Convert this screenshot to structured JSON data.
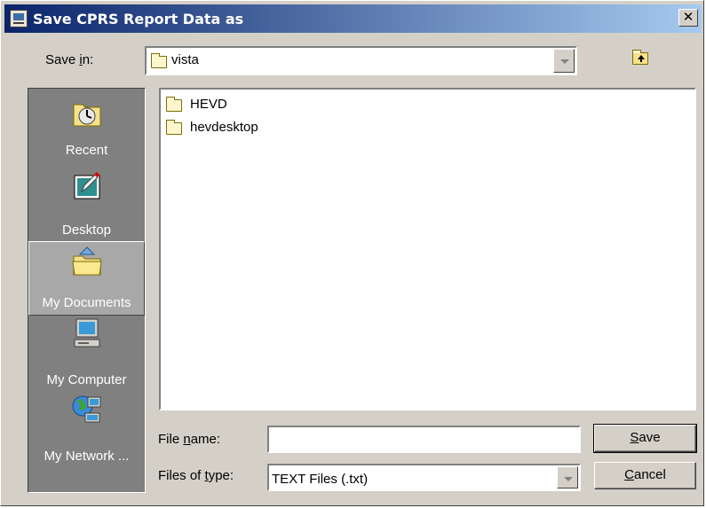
{
  "window": {
    "title": "Save CPRS Report Data as",
    "close_glyph": "✕"
  },
  "save_in": {
    "label_pre": "Save ",
    "label_accel": "i",
    "label_post": "n:",
    "value": "vista",
    "up_folder_icon": "up-one-level-icon"
  },
  "places": [
    {
      "label": "Recent",
      "icon": "recent-icon",
      "selected": false
    },
    {
      "label": "Desktop",
      "icon": "desktop-icon",
      "selected": false
    },
    {
      "label": "My Documents",
      "icon": "my-documents-icon",
      "selected": true
    },
    {
      "label": "My Computer",
      "icon": "my-computer-icon",
      "selected": false
    },
    {
      "label": "My Network ...",
      "icon": "my-network-icon",
      "selected": false
    }
  ],
  "files": [
    {
      "name": "HEVD",
      "icon": "folder-icon"
    },
    {
      "name": "hevdesktop",
      "icon": "folder-icon"
    }
  ],
  "file_name": {
    "label_pre": "File ",
    "label_accel": "n",
    "label_post": "ame:",
    "value": ""
  },
  "file_type": {
    "label_pre": "Files of ",
    "label_accel": "t",
    "label_post": "ype:",
    "value": "TEXT Files (.txt)"
  },
  "buttons": {
    "save_accel": "S",
    "save_rest": "ave",
    "cancel_accel": "C",
    "cancel_rest": "ancel"
  },
  "colors": {
    "titlebar_start": "#0a246a",
    "titlebar_end": "#a6caf0",
    "face": "#d4d0c8",
    "places_bg": "#808080"
  }
}
